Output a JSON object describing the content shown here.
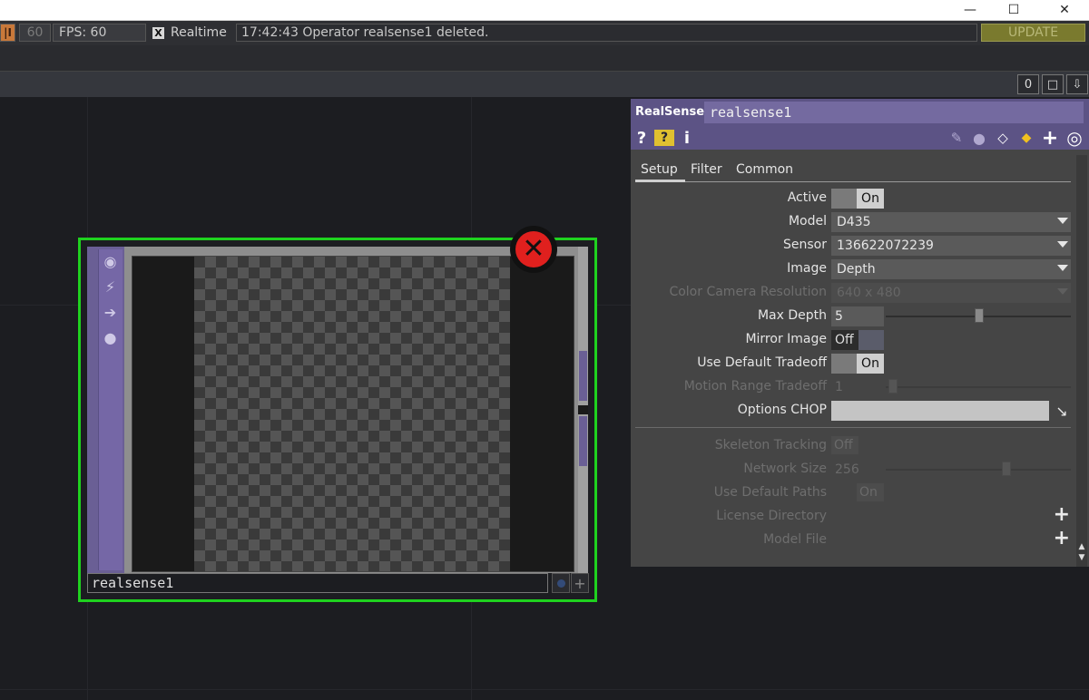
{
  "window": {
    "minimize_glyph": "—",
    "maximize_glyph": "☐",
    "close_glyph": "✕"
  },
  "toolbar": {
    "play_glyph": "|I",
    "frame_count": "60",
    "fps_label": "FPS:  60",
    "realtime_checked": "X",
    "realtime_label": "Realtime",
    "status_message": "17:42:43 Operator realsense1 deleted.",
    "update_label": "UPDATE"
  },
  "pane_bar": {
    "count": "0",
    "maximize_glyph": "□",
    "download_glyph": "⇩"
  },
  "node": {
    "name": "realsense1",
    "side_icons": [
      "viewer-icon",
      "bypass-icon",
      "arrow-icon",
      "lock-icon"
    ],
    "error_glyph": "✕",
    "plus_glyph": "+",
    "border_color": "#1fd21f",
    "side_color": "#6a5f95"
  },
  "panel": {
    "op_type": "RealSense",
    "op_name": "realsense1",
    "header_color": "#5c5385",
    "icons": {
      "help": "?",
      "info": "i"
    },
    "tabs": [
      "Setup",
      "Filter",
      "Common"
    ],
    "params": {
      "active": {
        "label": "Active",
        "value": "On"
      },
      "model": {
        "label": "Model",
        "value": "D435"
      },
      "sensor": {
        "label": "Sensor",
        "value": "136622072239"
      },
      "image": {
        "label": "Image",
        "value": "Depth"
      },
      "color_res": {
        "label": "Color Camera Resolution",
        "value": "640 x 480"
      },
      "max_depth": {
        "label": "Max Depth",
        "value": "5"
      },
      "mirror": {
        "label": "Mirror Image",
        "value": "Off"
      },
      "default_tradeoff": {
        "label": "Use Default Tradeoff",
        "value": "On"
      },
      "motion_tradeoff": {
        "label": "Motion Range Tradeoff",
        "value": "1"
      },
      "options_chop": {
        "label": "Options CHOP",
        "value": ""
      },
      "skeleton": {
        "label": "Skeleton Tracking",
        "value": "Off"
      },
      "network_size": {
        "label": "Network Size",
        "value": "256"
      },
      "default_paths": {
        "label": "Use Default Paths",
        "value": "On"
      },
      "license_dir": {
        "label": "License Directory"
      },
      "model_file": {
        "label": "Model File"
      }
    }
  }
}
